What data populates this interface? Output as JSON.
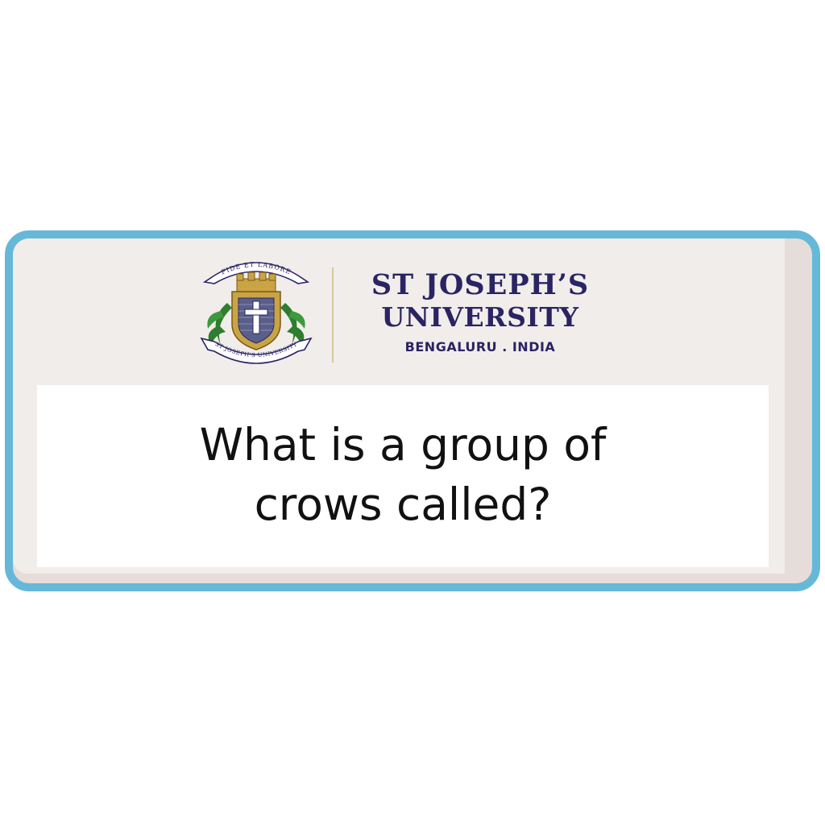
{
  "logo": {
    "motto": "FIDE ET LABORE",
    "ribbon": "ST JOSEPH'S UNIVERSITY",
    "icon": "university-crest-icon"
  },
  "university": {
    "line1": "ST  JOSEPH’S",
    "line2": "UNIVERSITY",
    "line3": "BENGALURU . INDIA"
  },
  "question": {
    "text": "What is a group of crows called?"
  },
  "colors": {
    "frame_border": "#66b8d9",
    "card_background": "#f1edeb",
    "brand_navy": "#2a2463",
    "crest_gold": "#c9a445",
    "leaf_green": "#2f7d2f"
  }
}
